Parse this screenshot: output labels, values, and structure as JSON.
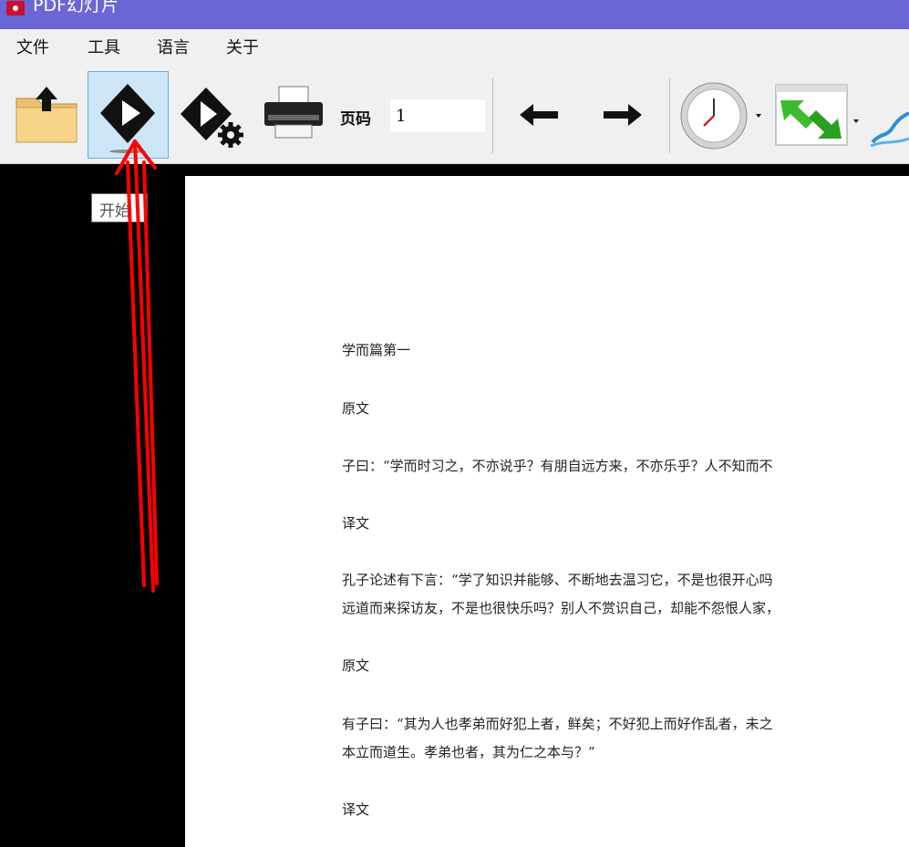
{
  "window": {
    "title": "PDF幻灯片"
  },
  "menu": {
    "items": [
      "文件",
      "工具",
      "语言",
      "关于"
    ]
  },
  "toolbar": {
    "page_label": "页码",
    "page_value": "1"
  },
  "tooltip": {
    "text": "开始"
  },
  "document": {
    "lines": [
      "学而篇第一",
      "原文",
      "子曰：“学而时习之，不亦说乎？有朋自远方来，不亦乐乎？人不知而不",
      "译文",
      "孔子论述有下言：“学了知识并能够、不断地去温习它，不是也很开心吗",
      "远道而来探访友，不是也很快乐吗？别人不赏识自己，却能不怨恨人家，",
      "原文",
      "有子曰：“其为人也孝弟而好犯上者，鲜矣；不好犯上而好作乱者，未之",
      "本立而道生。孝弟也者，其为仁之本与？”",
      "译文"
    ]
  },
  "colors": {
    "titlebar": "#6a66d6",
    "annotation": "#ff0000",
    "selected_button": "#cde6f7"
  }
}
